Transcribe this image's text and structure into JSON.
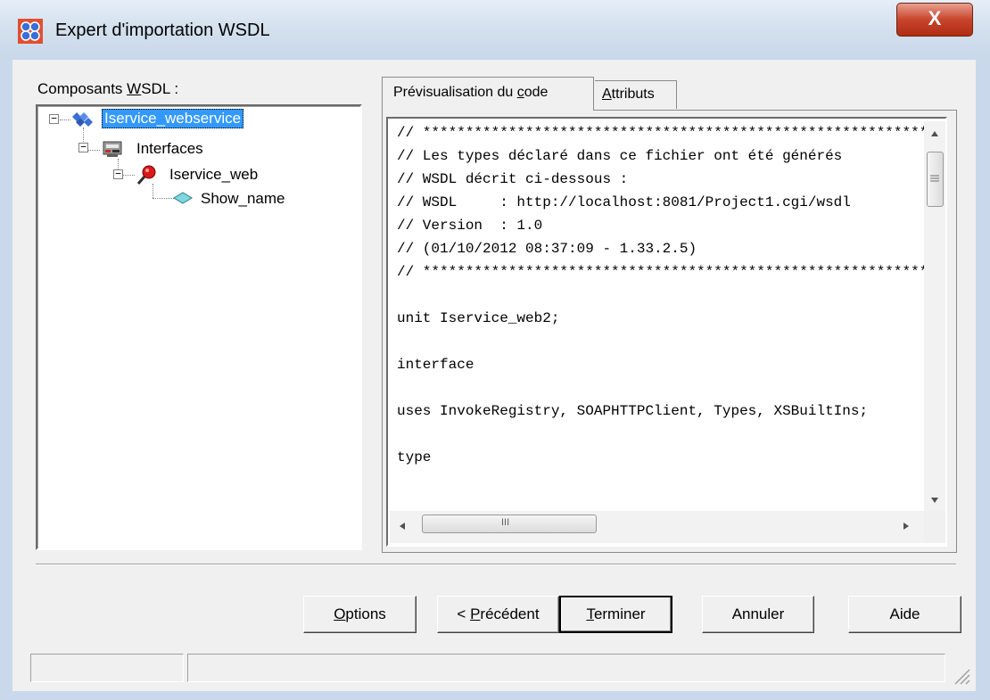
{
  "window": {
    "title": "Expert d'importation WSDL",
    "close_label": "X"
  },
  "tree": {
    "label_prefix": "Composants ",
    "label_access": "W",
    "label_suffix": "SDL :",
    "nodes": [
      {
        "label": "Iservice_webservice",
        "icon": "service-icon",
        "expander": "−"
      },
      {
        "label": "Interfaces",
        "icon": "interfaces-icon",
        "expander": "−"
      },
      {
        "label": "Iservice_web",
        "icon": "interface-pin-icon",
        "expander": "−"
      },
      {
        "label": "Show_name",
        "icon": "method-icon"
      }
    ]
  },
  "tabs": {
    "preview_prefix": "Prévisualisation du ",
    "preview_access": "c",
    "preview_suffix": "ode",
    "attributes_access": "A",
    "attributes_suffix": "ttributs"
  },
  "code": {
    "lines": [
      "// *********************************************************************",
      "// Les types déclaré dans ce fichier ont été générés",
      "// WSDL décrit ci-dessous :",
      "// WSDL     : http://localhost:8081/Project1.cgi/wsdl",
      "// Version  : 1.0",
      "// (01/10/2012 08:37:09 - 1.33.2.5)",
      "// *********************************************************************",
      "",
      "unit Iservice_web2;",
      "",
      "interface",
      "",
      "uses InvokeRegistry, SOAPHTTPClient, Types, XSBuiltIns;",
      "",
      "type"
    ],
    "hscroll_grip": "III"
  },
  "buttons": {
    "options_access": "O",
    "options_suffix": "ptions",
    "previous_prefix": "< ",
    "previous_access": "P",
    "previous_suffix": "récédent",
    "finish_access": "T",
    "finish_suffix": "erminer",
    "cancel": "Annuler",
    "help": "Aide"
  }
}
